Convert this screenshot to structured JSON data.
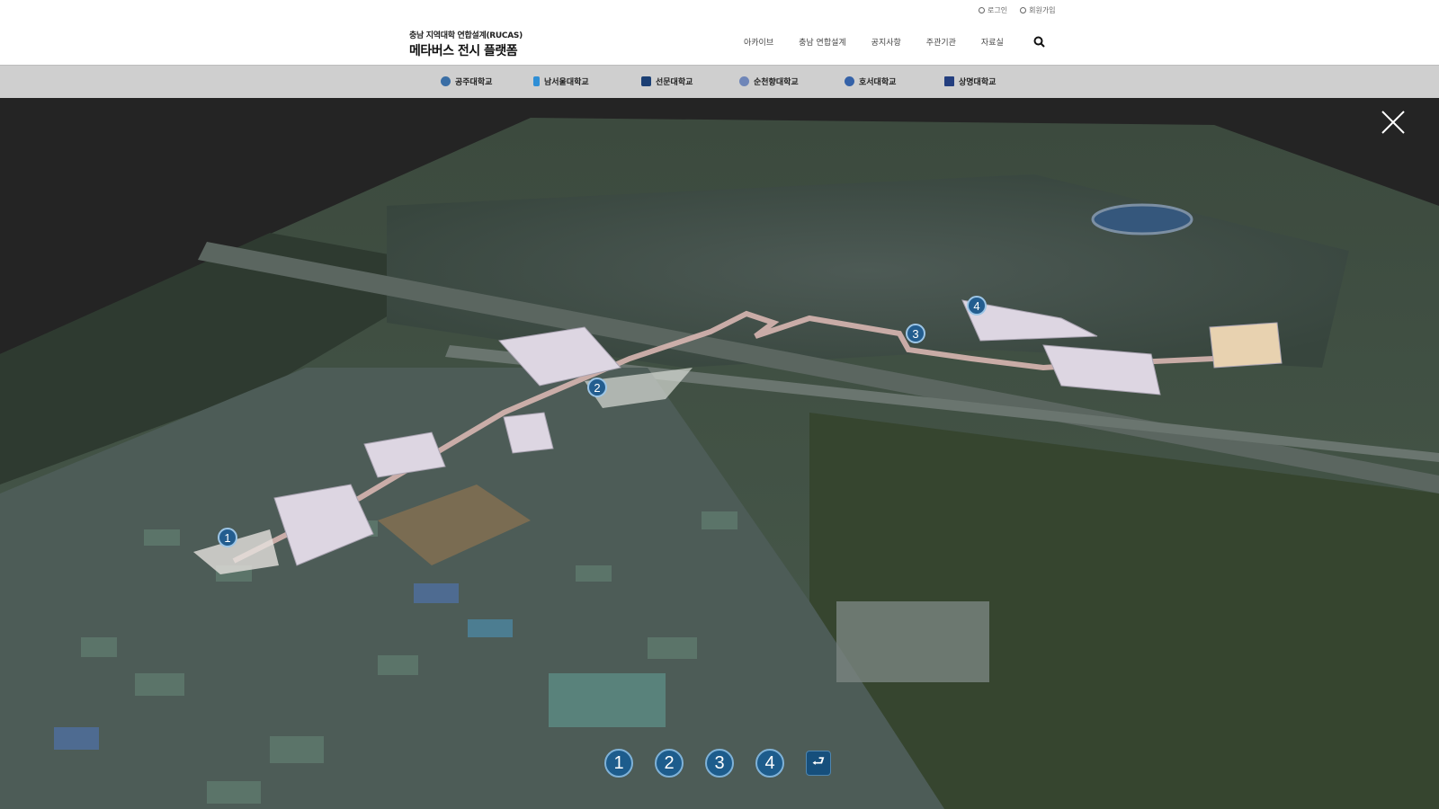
{
  "header": {
    "utility": {
      "login": "로그인",
      "signup": "회원가입"
    },
    "logo": {
      "subtitle": "충남 지역대학 연합설계(RUCAS)",
      "title": "메타버스 전시 플랫폼"
    },
    "menu": [
      "아카이브",
      "충남 연합설계",
      "공지사항",
      "주관기관",
      "자료실"
    ]
  },
  "universities": [
    "공주대학교",
    "남서울대학교",
    "선문대학교",
    "순천향대학교",
    "호서대학교",
    "상명대학교"
  ],
  "viewer": {
    "markers": [
      "1",
      "2",
      "3",
      "4"
    ],
    "nav_buttons": [
      "1",
      "2",
      "3",
      "4"
    ],
    "back_symbol": "⮐",
    "close_symbol": "✕"
  },
  "colors": {
    "header_bg": "#ffffff",
    "unibar_bg": "#cfcfcf",
    "viewer_bg": "#242424",
    "marker_blue": "#235d8f"
  }
}
